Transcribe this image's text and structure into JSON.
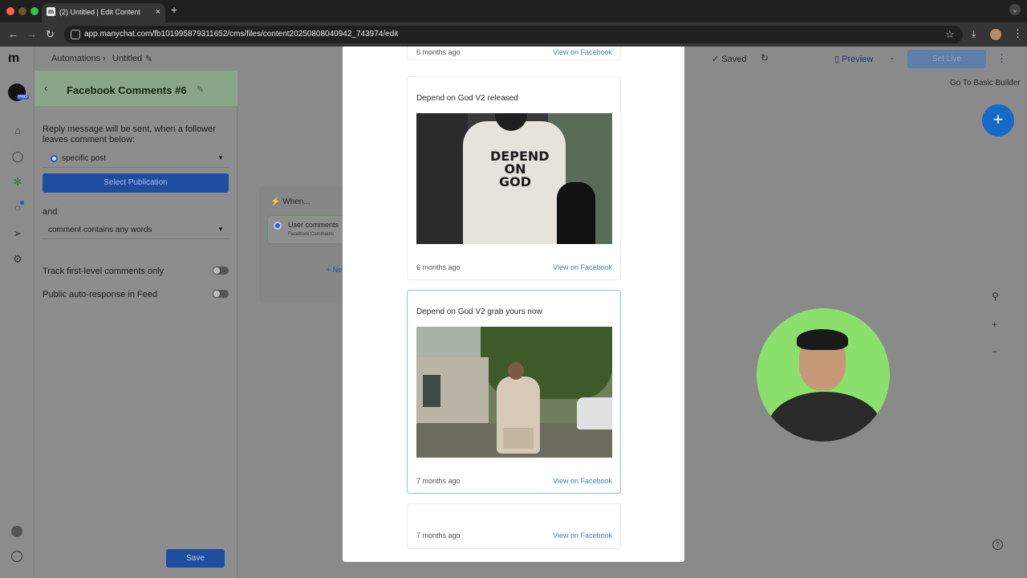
{
  "browser": {
    "tab_title": "(2) Untitled | Edit Content",
    "url": "app.manychat.com/fb101995879311652/cms/files/content20250808040942_743974/edit"
  },
  "topbar": {
    "crumb_automations": "Automations",
    "crumb_sep": "›",
    "crumb_untitled": "Untitled",
    "saved": "✓ Saved",
    "preview": "Preview",
    "set_live": "Set Live",
    "basic_builder": "Go To Basic Builder"
  },
  "panel": {
    "title": "Facebook Comments #6",
    "reply_text": "Reply message will be sent, when a follower leaves comment below:",
    "post_select": "specific post",
    "select_publication": "Select Publication",
    "and": "and",
    "comment_condition": "comment contains any words",
    "track_label": "Track first-level comments only",
    "public_label": "Public auto-response in Feed",
    "save": "Save"
  },
  "canvas": {
    "when": "When...",
    "trigger_title": "User comments",
    "trigger_sub": "Facebook Comments",
    "new_trigger": "+ Ne"
  },
  "modal": {
    "cards": [
      {
        "ago": "6 months ago",
        "fb": "View on Facebook"
      },
      {
        "title": "Depend on God V2 released",
        "ago": "6 months ago",
        "fb": "View on Facebook",
        "img_text": "DEPEND ON GOD"
      },
      {
        "title": "Depend on God V2 grab yours now",
        "ago": "7 months ago",
        "fb": "View on Facebook"
      },
      {
        "ago": "7 months ago",
        "fb": "View on Facebook"
      }
    ]
  },
  "colors": {
    "accent": "#1668c9",
    "link": "#3b7fc4",
    "selected_border": "#8ec0ee",
    "panel_header": "#8aa688"
  }
}
